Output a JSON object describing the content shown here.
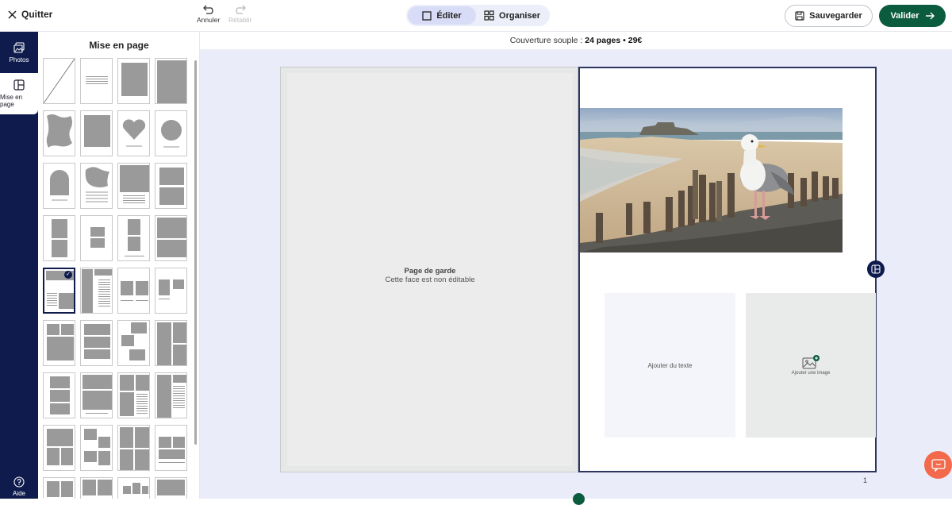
{
  "header": {
    "quit_label": "Quitter",
    "undo_label": "Annuler",
    "redo_label": "Rétablir",
    "tabs": [
      {
        "label": "Éditer",
        "active": true
      },
      {
        "label": "Organiser",
        "active": false
      }
    ],
    "save_label": "Sauvegarder",
    "validate_label": "Valider"
  },
  "rail": {
    "items": [
      {
        "label": "Photos",
        "icon": "photos-icon"
      },
      {
        "label": "Mise en page",
        "icon": "layout-icon",
        "active": true
      }
    ],
    "help_label": "Aide"
  },
  "panel": {
    "title": "Mise en page",
    "selected_index": 16
  },
  "info": {
    "prefix": "Couverture souple : ",
    "details": "24 pages • 29€"
  },
  "left_page": {
    "title": "Page de garde",
    "subtitle": "Cette face est non éditable"
  },
  "right_page": {
    "text_placeholder": "Ajouter du texte",
    "image_placeholder": "Ajouter une image",
    "page_number": "1"
  },
  "colors": {
    "navy": "#0f1b4c",
    "green": "#0b5c3e",
    "chat": "#f26a4b"
  }
}
